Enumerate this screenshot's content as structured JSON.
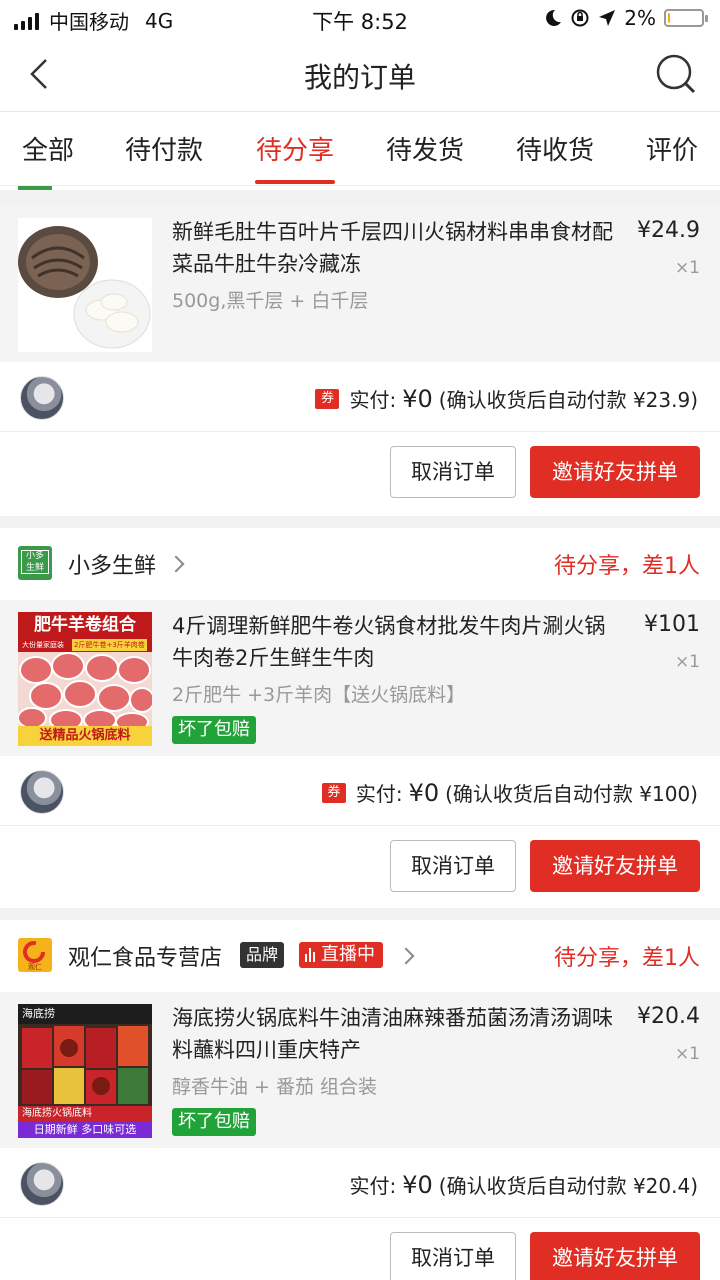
{
  "status_bar": {
    "carrier": "中国移动",
    "network": "4G",
    "time": "下午 8:52",
    "battery": "2%",
    "battery_level": 0.02
  },
  "nav": {
    "title": "我的订单"
  },
  "tabs": [
    {
      "label": "全部"
    },
    {
      "label": "待付款"
    },
    {
      "label": "待分享",
      "active": true
    },
    {
      "label": "待发货"
    },
    {
      "label": "待收货"
    },
    {
      "label": "评价"
    }
  ],
  "orders": [
    {
      "product": {
        "name": "新鲜毛肚牛百叶片千层四川火锅材料串串食材配菜品牛肚牛杂冷藏冻",
        "spec": "500g,黑千层 + 白千层",
        "price": "¥24.9",
        "qty": "×1"
      },
      "pay": {
        "coupon": "券",
        "label": "实付:",
        "amount": "¥0",
        "note": "(确认收货后自动付款 ¥23.9)"
      },
      "buttons": {
        "cancel": "取消订单",
        "invite": "邀请好友拼单"
      }
    },
    {
      "shop": {
        "logo_text": "小多生鲜",
        "name": "小多生鲜",
        "status": "待分享，差1人"
      },
      "product": {
        "name": "4斤调理新鲜肥牛卷火锅食材批发牛肉片涮火锅牛肉卷2斤生鲜生牛肉",
        "spec": "2斤肥牛 +3斤羊肉【送火锅底料】",
        "badge": "坏了包赔",
        "price": "¥101",
        "qty": "×1",
        "thumb_title": "肥牛羊卷组合",
        "thumb_sub": "大份量家庭装",
        "thumb_tag": "2斤肥牛卷+3斤羊肉卷",
        "thumb_footer": "送精品火锅底料"
      },
      "pay": {
        "coupon": "券",
        "label": "实付:",
        "amount": "¥0",
        "note": "(确认收货后自动付款 ¥100)"
      },
      "buttons": {
        "cancel": "取消订单",
        "invite": "邀请好友拼单"
      }
    },
    {
      "shop": {
        "logo_text": "观仁",
        "name": "观仁食品专营店",
        "brand": "品牌",
        "live": "直播中",
        "status": "待分享，差1人"
      },
      "product": {
        "name": "海底捞火锅底料牛油清油麻辣番茄菌汤清汤调味料蘸料四川重庆特产",
        "spec": "醇香牛油 + 番茄 组合装",
        "badge": "坏了包赔",
        "price": "¥20.4",
        "qty": "×1",
        "thumb_brand": "海底捞",
        "thumb_caption": "海底捞火锅底料",
        "thumb_footer": "日期新鲜 多口味可选"
      },
      "pay": {
        "label": "实付:",
        "amount": "¥0",
        "note": "(确认收货后自动付款 ¥20.4)"
      },
      "buttons": {
        "cancel": "取消订单",
        "invite": "邀请好友拼单"
      }
    }
  ],
  "colors": {
    "accent": "#e02e24",
    "green": "#22a33a",
    "background": "#f2f2f2"
  }
}
